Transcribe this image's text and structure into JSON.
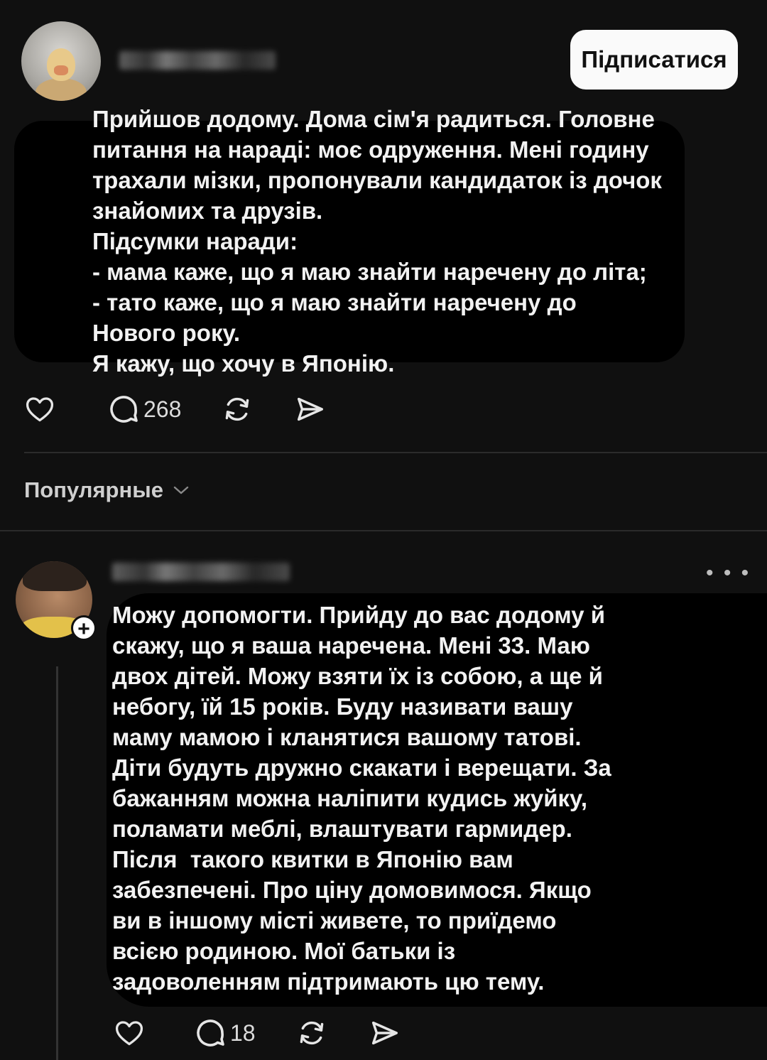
{
  "post": {
    "subscribe_label": "Підписатися",
    "lines": [
      "Прийшов додому. Дома сім'я радиться. Головне",
      "питання на нараді: моє одруження. Мені годину",
      "трахали мізки, пропонували кандидаток із дочок",
      "знайомих та друзів.",
      "Підсумки наради:",
      "- мама каже, що я маю знайти наречену до літа;",
      "- тато каже, що я маю знайти наречену до",
      "Нового року.",
      "Я кажу, що хочу в Японію."
    ],
    "comment_count": "268",
    "icons": [
      "heart-icon",
      "comment-icon",
      "repost-icon",
      "share-icon"
    ]
  },
  "sort": {
    "label": "Популярные"
  },
  "reply": {
    "more_label": "• • •",
    "follow_label": "+",
    "lines": [
      "Можу допомогти. Прийду до вас додому й",
      "скажу, що я ваша наречена. Мені 33. Маю",
      "двох дітей. Можу взяти їх із собою, а ще й",
      "небогу, їй 15 років. Буду називати вашу",
      "маму мамою і кланятися вашому татові.",
      "Діти будуть дружно скакати і верещати. За",
      "бажанням можна наліпити кудись жуйку,",
      "поламати меблі, влаштувати гармидер.",
      "Після  такого квитки в Японію вам",
      "забезпечені. Про ціну домовимося. Якщо",
      "ви в іншому місті живете, то приїдемо",
      "всією родиною. Мої батьки із",
      "задоволенням підтримають цю тему."
    ],
    "comment_count": "18"
  },
  "colors": {
    "background": "#101010",
    "text_bg": "#000000",
    "text": "#f2f2f2",
    "button_bg": "#fafafa"
  }
}
